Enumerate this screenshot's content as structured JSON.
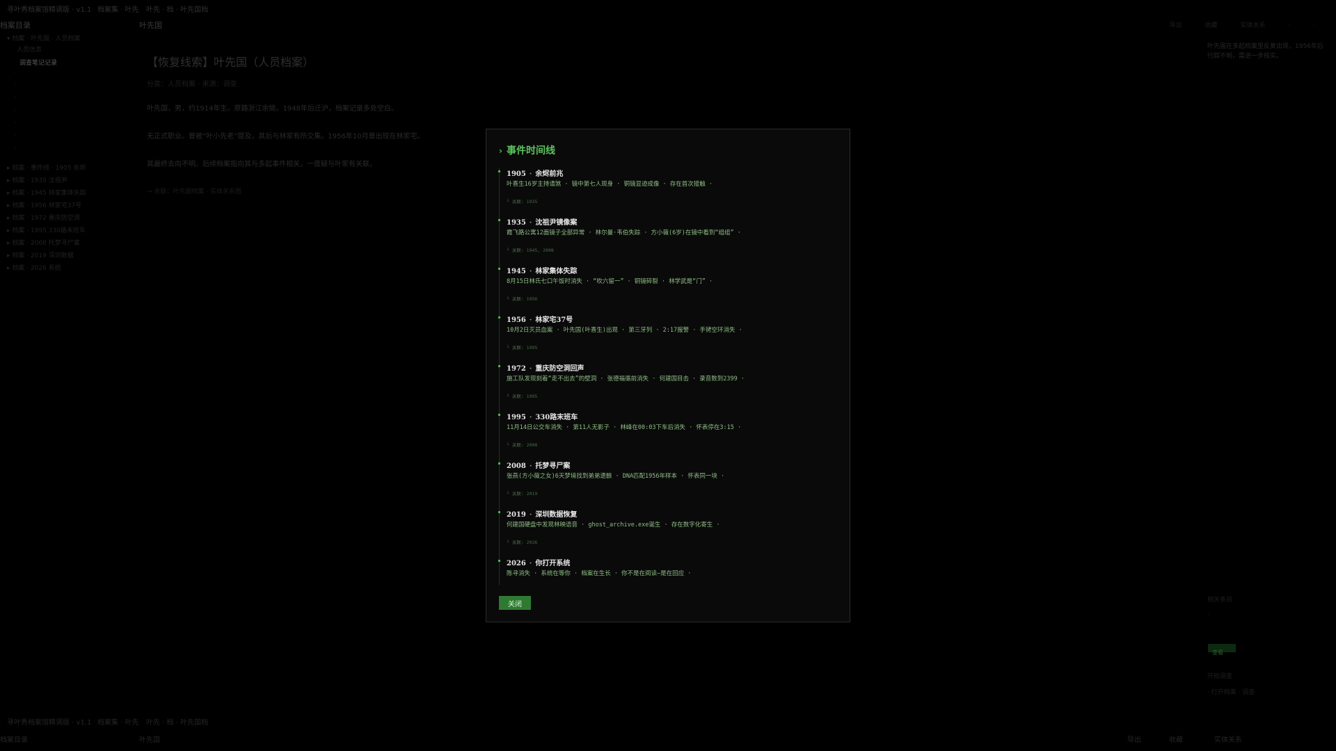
{
  "colors": {
    "accent": "#5cc25f",
    "button_bg": "#2f7a32",
    "modal_bg": "#0a0a0a",
    "overlay": "#000000"
  },
  "app": {
    "topbar": [
      "寻叶秀档案馆精调版 · v1.1",
      "档案集 · 叶先",
      "叶先 · 档 · 叶先国档"
    ],
    "sidebar_title": "档案目录",
    "file_title": "叶先国",
    "top_actions": [
      "导出",
      "收藏",
      "实体关系",
      "·",
      "·"
    ],
    "tree": [
      "▾ 档案 · 叶先国 · 人员档案",
      "人员信息",
      "调查笔记记录",
      "·",
      "·",
      "·",
      "·",
      "·",
      "·",
      "·",
      "▸ 档案 · 事件线 · 1905 余烬",
      "▸ 档案 · 1935 沈祖尹",
      "▸ 档案 · 1945 林家集体失踪",
      "▸ 档案 · 1956 林家宅37号",
      "▸ 档案 · 1972 重庆防空洞",
      "▸ 档案 · 1995 330路末班车",
      "▸ 档案 · 2008 托梦寻尸案",
      "▸ 档案 · 2019 深圳数据",
      "▸ 档案 · 2026 系统"
    ],
    "doc_title": "【恢复线索】叶先国（人员档案）",
    "doc_meta": "分类：人员档案 · 来源：调查",
    "doc_paras": [
      "叶先国，男，约1914年生。原籍浙江余姚。1948年后迁沪，档案记录多处空白。",
      "无正式职业。曾被“叶小先老”提及，其后与林家有所交集。1956年10月曾出现在林家宅。",
      "其最终去向不明。后续档案指向其与多起事件相关，一度疑与叶家有关联。"
    ],
    "doc_link": "→ 关联：叶先国档案 · 实体关系图",
    "right_note": "叶先国在多起档案里反复出现，1956年后行踪不明，需进一步核实。",
    "right_lower": [
      "相关条目",
      "·",
      "·",
      "查看",
      "开始调查",
      "· 打开档案 · 调查"
    ],
    "bottom_bar": [
      "寻叶秀档案馆精调版 · v1.1",
      "档案集 · 叶先",
      "叶先 · 档 · 叶先国档",
      "档案目录",
      "叶先国",
      "导出",
      "收藏",
      "实体关系"
    ]
  },
  "modal": {
    "title": "事件时间线",
    "events": [
      {
        "year": "1905",
        "name": "余烬前兆",
        "desc": "叶喜生16岁主持请煞 · 镜中第七人现身 · 铜镜显迹成像 · 存在首次接触 ·",
        "related": "└ 关联: 1935"
      },
      {
        "year": "1935",
        "name": "沈祖尹镜像案",
        "desc": "霞飞路公寓12面镜子全部异常 · 林尔曼·韦伯失踪 · 方小薇(6岁)在镜中看到“组组” ·",
        "related": "└ 关联: 1945, 2008"
      },
      {
        "year": "1945",
        "name": "林家集体失踪",
        "desc": "8月15日林氏七口午饭时消失 · “吹六留一” · 铜镜碎裂 · 林学武是“门” ·",
        "related": "└ 关联: 1956"
      },
      {
        "year": "1956",
        "name": "林家宅37号",
        "desc": "10月2日灭员血案 · 叶先国(叶喜生)出现 · 第三牙列 · 2:17报警 · 手铐空环消失 ·",
        "related": "└ 关联: 1995"
      },
      {
        "year": "1972",
        "name": "重庆防空洞回声",
        "desc": "施工队发现刻着“走不出去”的壁洞 · 张德福循前消失 · 何建国目击 · 录音数到2399 ·",
        "related": "└ 关联: 1995"
      },
      {
        "year": "1995",
        "name": "330路末班车",
        "desc": "11月14日公交车消失 · 第11人无影子 · 林峰在00:03下车后消失 · 怀表停在3:15 ·",
        "related": "└ 关联: 2008"
      },
      {
        "year": "2008",
        "name": "托梦寻尸案",
        "desc": "张燕(方小薇之女)6天梦境找到弟弟遗骸 · DNA匹配1956年样本 · 怀表同一块 ·",
        "related": "└ 关联: 2019"
      },
      {
        "year": "2019",
        "name": "深圳数据恢复",
        "desc": "何建国硬盘中发现林映语音 · ghost_archive.exe诞生 · 存在数字化寄生 ·",
        "related": "└ 关联: 2026"
      },
      {
        "year": "2026",
        "name": "你打开系统",
        "desc": "陈寻消失 · 系统在等你 · 档案在生长 · 你不是在阅读—是在回应 ·",
        "related": ""
      }
    ],
    "close_label": "关闭"
  }
}
